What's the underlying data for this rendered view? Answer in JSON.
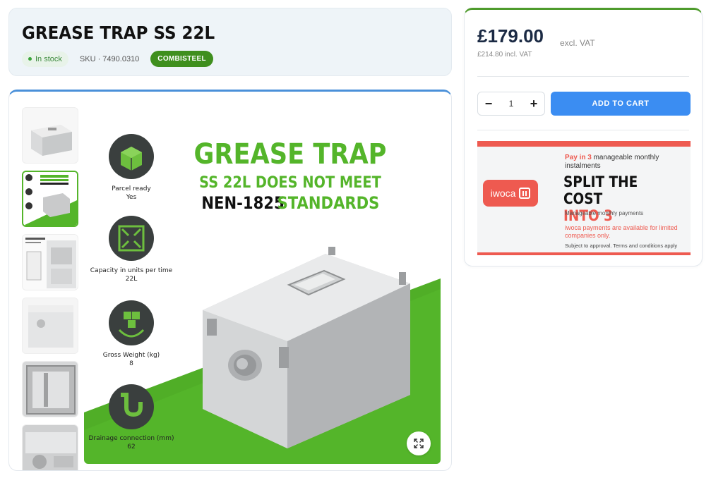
{
  "product": {
    "title": "GREASE TRAP SS 22L",
    "stock": "In stock",
    "sku": "SKU · 7490.0310",
    "brand": "COMBISTEEL"
  },
  "gallery": {
    "headline1": "GREASE TRAP",
    "headline2": "SS 22L DOES NOT MEET",
    "headline3a": "NEN-1825",
    "headline3b": "STANDARDS",
    "features": [
      {
        "label": "Parcel ready",
        "value": "Yes"
      },
      {
        "label": "Capacity in units per time",
        "value": "22L"
      },
      {
        "label": "Gross Weight (kg)",
        "value": "8"
      },
      {
        "label": "Drainage connection (mm)",
        "value": "62"
      }
    ],
    "expand_icon": "expand-icon"
  },
  "pricing": {
    "price": "£179.00",
    "excl_vat": "excl. VAT",
    "incl_vat": "£214.80 incl. VAT",
    "qty": "1",
    "minus": "−",
    "plus": "+",
    "add_to_cart": "ADD TO CART"
  },
  "iwoca": {
    "logo_text": "iwoca",
    "pay_in_bold": "Pay in 3",
    "pay_in_rest": " manageable monthly instalments",
    "split_line1": "SPLIT THE COST",
    "split_line2": "INTO 3",
    "manageable": "Manageable monthly payments",
    "available": "iwoca payments are available for limited companies only.",
    "subject": "Subject to approval. Terms and conditions apply"
  },
  "colors": {
    "accent_green": "#54b52a",
    "brand_green": "#3f8f1e",
    "button_blue": "#3b8df2",
    "iwoca_red": "#ee5a50",
    "price_navy": "#1b2a44"
  }
}
